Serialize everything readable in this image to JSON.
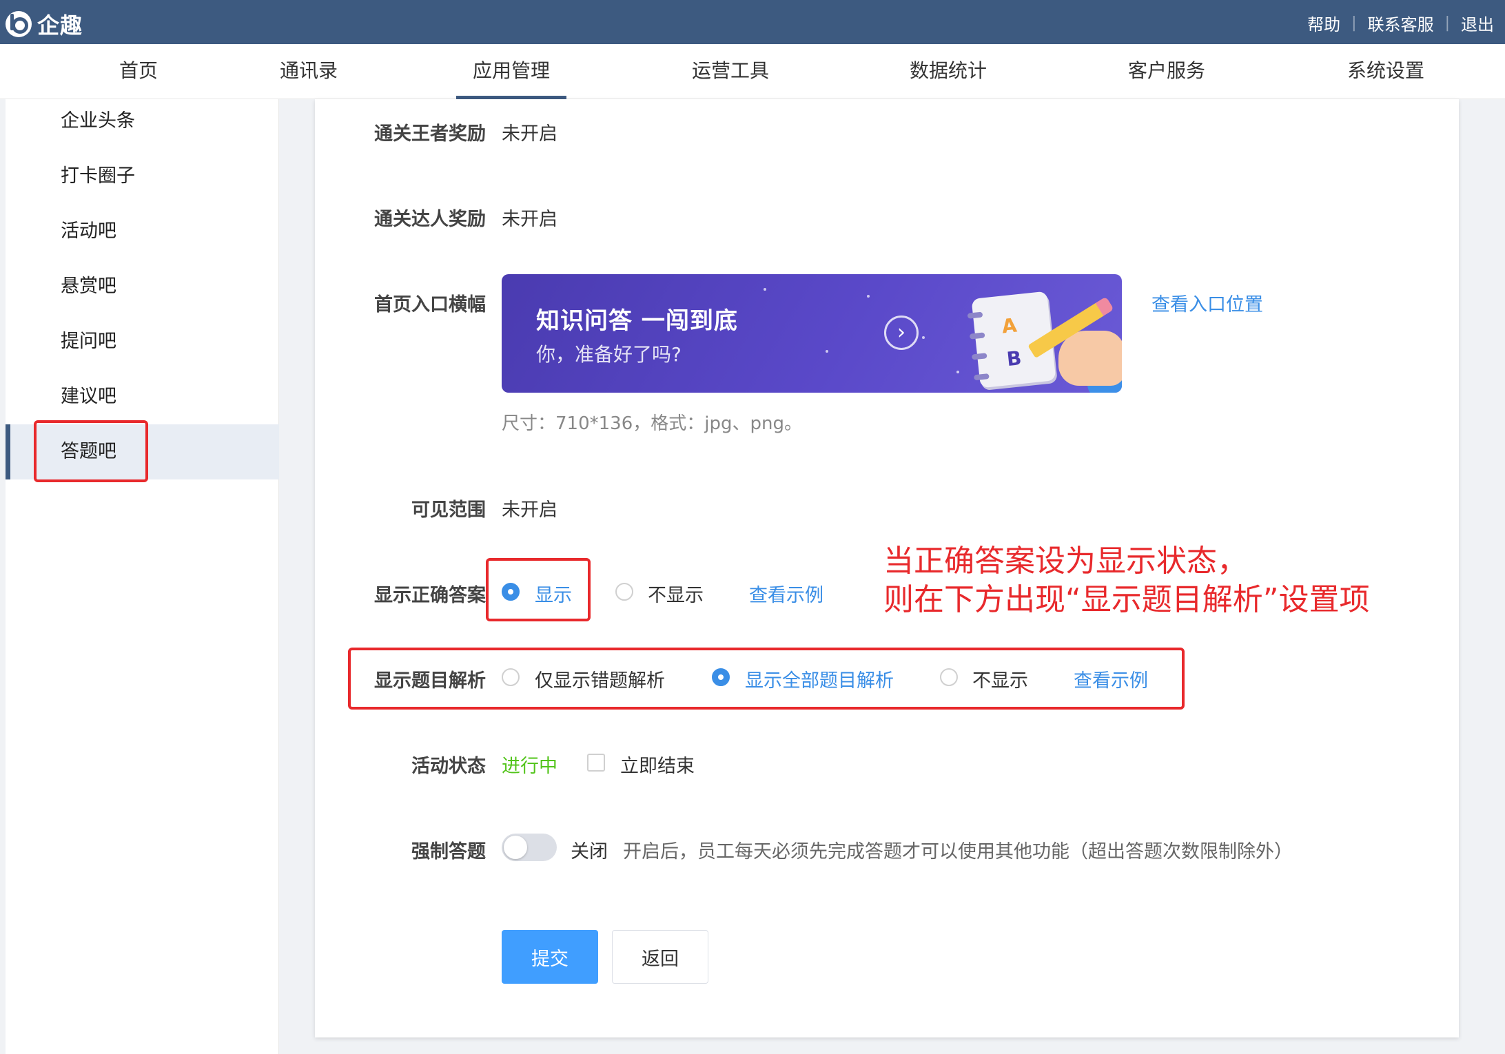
{
  "header": {
    "logo_text": "企趣",
    "links": [
      "帮助",
      "联系客服",
      "退出"
    ]
  },
  "nav": {
    "items": [
      "首页",
      "通讯录",
      "应用管理",
      "运营工具",
      "数据统计",
      "客户服务",
      "系统设置"
    ],
    "active": "应用管理"
  },
  "sidebar": {
    "items": [
      "企业头条",
      "打卡圈子",
      "活动吧",
      "悬赏吧",
      "提问吧",
      "建议吧",
      "答题吧"
    ],
    "active": "答题吧"
  },
  "form": {
    "king_reward": {
      "label": "通关王者奖励",
      "value": "未开启"
    },
    "expert_reward": {
      "label": "通关达人奖励",
      "value": "未开启"
    },
    "home_banner": {
      "label": "首页入口横幅",
      "banner_title": "知识问答 一闯到底",
      "banner_subtitle": "你，准备好了吗?",
      "banner_letter_a": "A",
      "banner_letter_b": "B",
      "view_link": "查看入口位置",
      "size_hint": "尺寸：710*136，格式：jpg、png。"
    },
    "visibility": {
      "label": "可见范围",
      "value": "未开启"
    },
    "show_answer": {
      "label": "显示正确答案",
      "options": [
        "显示",
        "不显示"
      ],
      "selected": "显示",
      "example_link": "查看示例"
    },
    "show_analysis": {
      "label": "显示题目解析",
      "options": [
        "仅显示错题解析",
        "显示全部题目解析",
        "不显示"
      ],
      "selected": "显示全部题目解析",
      "example_link": "查看示例"
    },
    "activity_status": {
      "label": "活动状态",
      "value": "进行中",
      "end_now_label": "立即结束",
      "end_now_checked": false
    },
    "force_answer": {
      "label": "强制答题",
      "enabled": false,
      "state_label": "关闭",
      "description": "开启后，员工每天必须先完成答题才可以使用其他功能（超出答题次数限制除外）"
    },
    "buttons": {
      "submit": "提交",
      "back": "返回"
    }
  },
  "annotation": {
    "line1": "当正确答案设为显示状态，",
    "line2": "则在下方出现“显示题目解析”设置项"
  },
  "colors": {
    "header_bg": "#3d5a80",
    "link": "#3a8ee6",
    "primary_button": "#409eff",
    "status_green": "#52c41a",
    "annotation_red": "#e8292c"
  }
}
